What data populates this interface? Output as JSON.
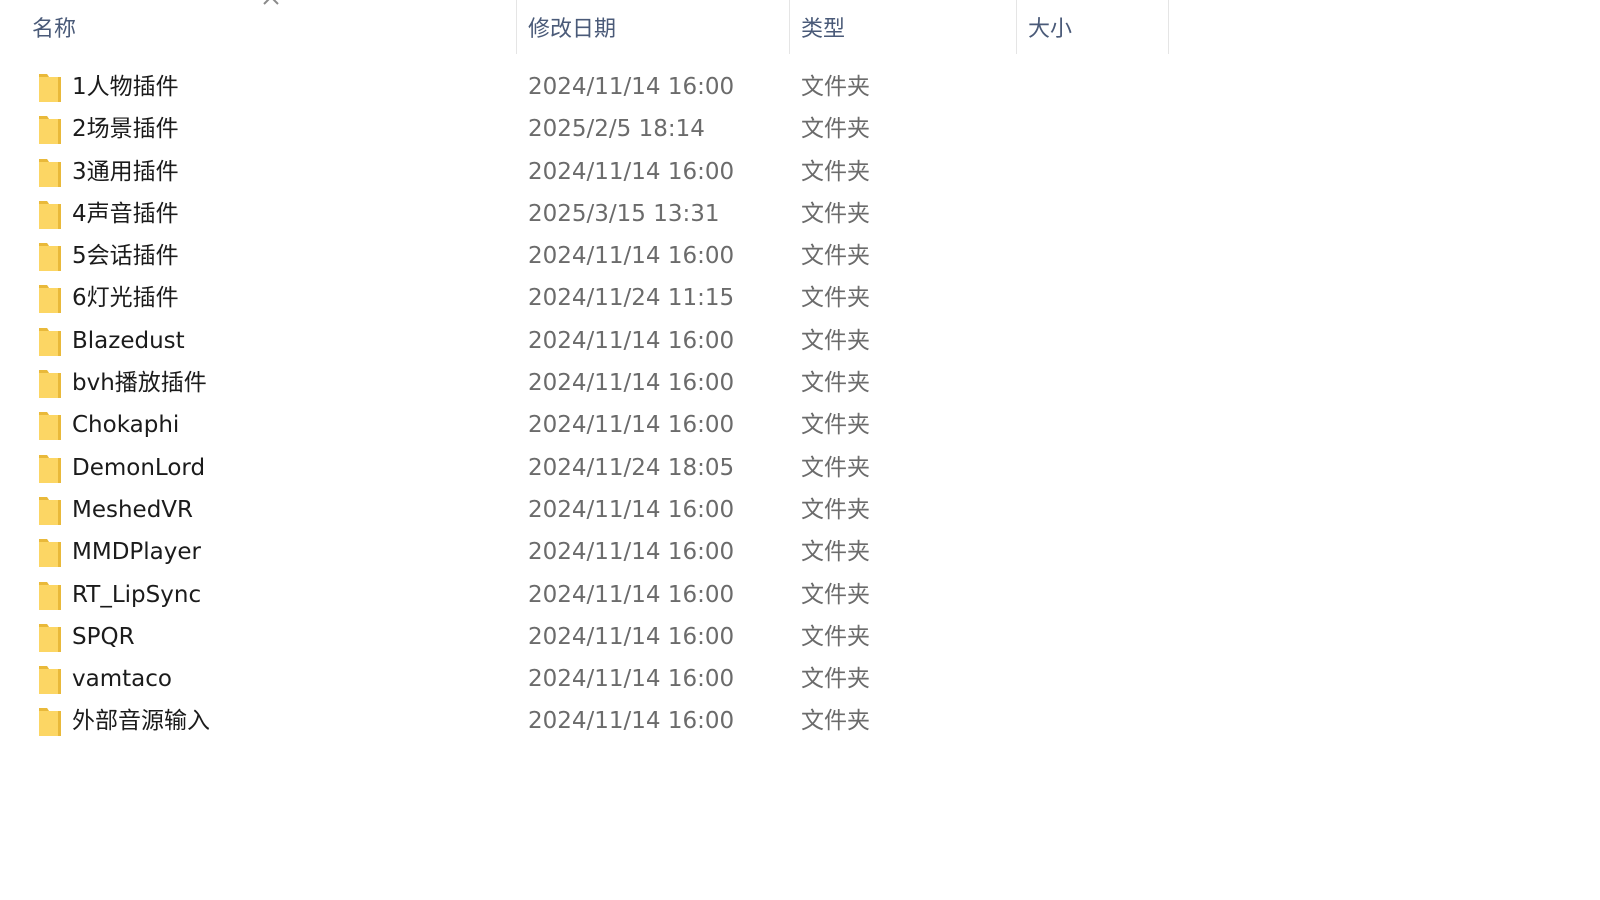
{
  "header": {
    "col_name": "名称",
    "col_date": "修改日期",
    "col_type": "类型",
    "col_size": "大小"
  },
  "colors": {
    "folder_fill": "#fcd664",
    "folder_shade": "#e9b93a",
    "header_text": "#4a5a78",
    "row_text": "#1b1b1b",
    "meta_text": "#6b6b6b"
  },
  "rows": [
    {
      "name": "1人物插件",
      "date": "2024/11/14 16:00",
      "type": "文件夹"
    },
    {
      "name": "2场景插件",
      "date": "2025/2/5 18:14",
      "type": "文件夹"
    },
    {
      "name": "3通用插件",
      "date": "2024/11/14 16:00",
      "type": "文件夹"
    },
    {
      "name": "4声音插件",
      "date": "2025/3/15 13:31",
      "type": "文件夹"
    },
    {
      "name": "5会话插件",
      "date": "2024/11/14 16:00",
      "type": "文件夹"
    },
    {
      "name": "6灯光插件",
      "date": "2024/11/24 11:15",
      "type": "文件夹"
    },
    {
      "name": "Blazedust",
      "date": "2024/11/14 16:00",
      "type": "文件夹"
    },
    {
      "name": "bvh播放插件",
      "date": "2024/11/14 16:00",
      "type": "文件夹"
    },
    {
      "name": "Chokaphi",
      "date": "2024/11/14 16:00",
      "type": "文件夹"
    },
    {
      "name": "DemonLord",
      "date": "2024/11/24 18:05",
      "type": "文件夹"
    },
    {
      "name": "MeshedVR",
      "date": "2024/11/14 16:00",
      "type": "文件夹"
    },
    {
      "name": "MMDPlayer",
      "date": "2024/11/14 16:00",
      "type": "文件夹"
    },
    {
      "name": "RT_LipSync",
      "date": "2024/11/14 16:00",
      "type": "文件夹"
    },
    {
      "name": "SPQR",
      "date": "2024/11/14 16:00",
      "type": "文件夹"
    },
    {
      "name": "vamtaco",
      "date": "2024/11/14 16:00",
      "type": "文件夹"
    },
    {
      "name": "外部音源输入",
      "date": "2024/11/14 16:00",
      "type": "文件夹"
    }
  ]
}
